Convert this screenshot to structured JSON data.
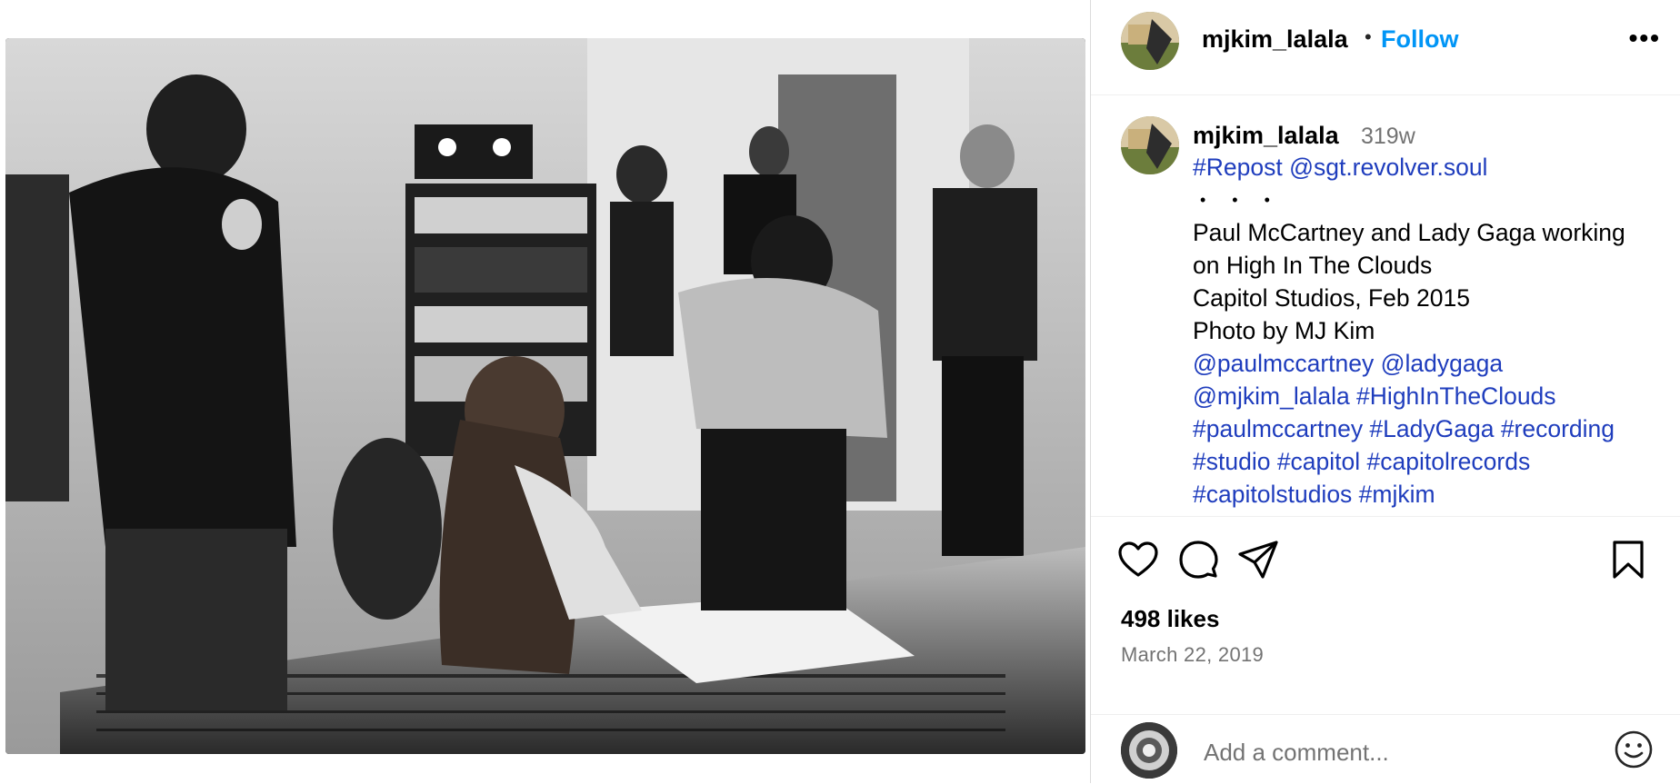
{
  "post": {
    "username": "mjkim_lalala",
    "separator": "•",
    "follow_label": "Follow",
    "more_label": "•••"
  },
  "caption": {
    "username": "mjkim_lalala",
    "age": "319w",
    "lines": [
      {
        "text": "#Repost @sgt.revolver.soul",
        "link": true
      },
      {
        "text": "• • •",
        "link": false
      },
      {
        "text": "Paul McCartney and Lady Gaga working",
        "link": false
      },
      {
        "text": "on High In The Clouds",
        "link": false
      },
      {
        "text": "Capitol Studios, Feb 2015",
        "link": false
      },
      {
        "text": "Photo by MJ Kim",
        "link": false
      },
      {
        "text": "@paulmccartney @ladygaga",
        "link": true
      },
      {
        "text": "@mjkim_lalala #HighInTheClouds",
        "link": true
      },
      {
        "text": "#paulmccartney #LadyGaga #recording",
        "link": true
      },
      {
        "text": "#studio #capitol #capitolrecords",
        "link": true
      },
      {
        "text": "#capitolstudios #mjkim",
        "link": true
      }
    ]
  },
  "actions": {
    "icons": [
      "heart-icon",
      "comment-icon",
      "share-icon",
      "bookmark-icon"
    ]
  },
  "stats": {
    "likes": "498 likes",
    "date": "March 22, 2019"
  },
  "comment": {
    "placeholder": "Add a comment...",
    "emoji_icon": "smiley-icon"
  },
  "colors": {
    "link": "#1f3dbd",
    "follow": "#0095f6",
    "muted": "#737373",
    "divider": "#efefef"
  }
}
